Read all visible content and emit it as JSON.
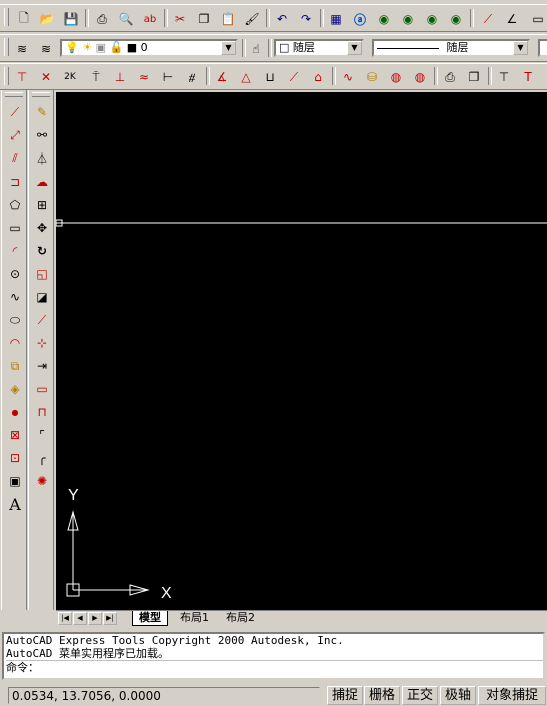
{
  "toolbar_standard": {
    "icons": [
      "new-icon",
      "open-icon",
      "save-icon",
      "print-icon",
      "print-preview-icon",
      "spell-check-icon",
      "cut-icon",
      "copy-icon",
      "paste-icon",
      "match-properties-icon",
      "undo-icon",
      "redo-icon",
      "designcenter-icon",
      "today-icon",
      "browser-icon",
      "hyperlink-icon",
      "globe-icon",
      "snap-from-icon",
      "ucs-icon",
      "named-views-icon"
    ]
  },
  "layer_bar": {
    "layer_name": "0",
    "color_value": "随层",
    "linetype_value": "随层"
  },
  "drawing": {
    "ucs_y_label": "Y",
    "ucs_x_label": "X",
    "background": "#000000",
    "line_color": "#ffffff"
  },
  "tabs": {
    "model": "模型",
    "layout1": "布局1",
    "layout2": "布局2"
  },
  "command": {
    "line1": "AutoCAD Express Tools Copyright   2000 Autodesk, Inc.",
    "line2": "AutoCAD 菜单实用程序已加载。",
    "prompt": "命令："
  },
  "status": {
    "coordinates": "0.0534,  13.7056, 0.0000",
    "snap": "捕捉",
    "grid": "栅格",
    "ortho": "正交",
    "polar": "极轴",
    "osnap": "对象捕捉"
  }
}
